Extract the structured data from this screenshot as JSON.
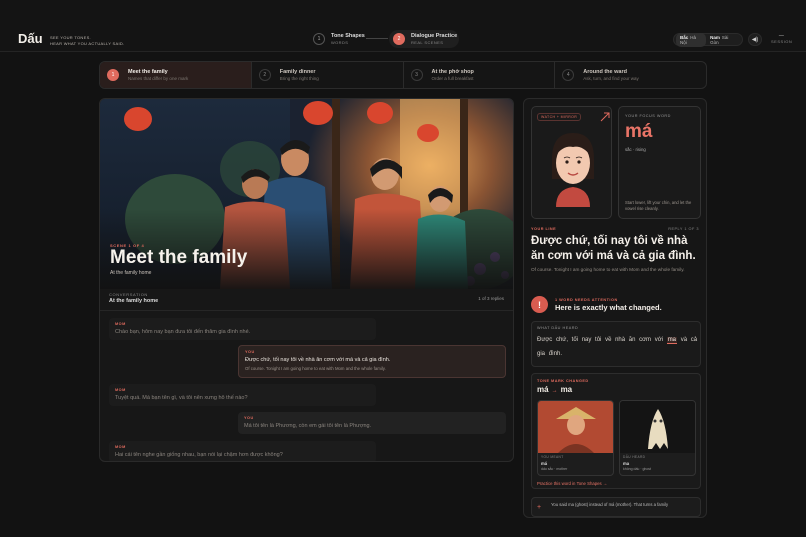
{
  "app": {
    "logo": "Dấu",
    "tagline_line1": "SEE YOUR TONES.",
    "tagline_line2": "HEAR WHAT YOU ACTUALLY SAID."
  },
  "steps": [
    {
      "num": "1",
      "title": "Tone Shapes",
      "subtitle": "WORDS"
    },
    {
      "num": "2",
      "title": "Dialogue Practice",
      "subtitle": "REAL SCENES"
    }
  ],
  "dialect": {
    "options": [
      {
        "name": "Bắc",
        "sub": "Hà Nội"
      },
      {
        "name": "Nam",
        "sub": "Sài Gòn"
      }
    ],
    "selected": "Bắc"
  },
  "session": {
    "value": "—",
    "label": "SESSION"
  },
  "scenes": [
    {
      "num": "1",
      "title": "Meet the family",
      "subtitle": "Names that differ by one mark"
    },
    {
      "num": "2",
      "title": "Family dinner",
      "subtitle": "Bring the right thing"
    },
    {
      "num": "3",
      "title": "At the phở shop",
      "subtitle": "Order a full breakfast"
    },
    {
      "num": "4",
      "title": "Around the ward",
      "subtitle": "Ask, turn, and find your way"
    }
  ],
  "scene": {
    "of_label": "SCENE 1 OF 4",
    "title": "Meet the family",
    "location": "At the family home"
  },
  "conversation": {
    "label": "CONVERSATION",
    "location": "At the family home",
    "count": "1 of 3 replies",
    "messages": [
      {
        "who": "MOM",
        "line": "Chào bạn, hôm nay bạn đưa tôi đến thăm gia đình nhé.",
        "tr": ""
      },
      {
        "who": "YOU",
        "line": "Được chứ, tối nay tôi về nhà ăn cơm với má và cả gia đình.",
        "tr": "Of course. Tonight I am going home to eat with Mom and the whole family."
      },
      {
        "who": "MOM",
        "line": "Tuyệt quá. Má bạn tên gì, và tôi nên xưng hô thế nào?",
        "tr": ""
      },
      {
        "who": "YOU",
        "line": "Má tôi tên là Phương, còn em gái tôi tên là Phượng.",
        "tr": ""
      },
      {
        "who": "MOM",
        "line": "Hai cái tên nghe gần giống nhau, bạn nói lại chậm hơn được không?",
        "tr": ""
      }
    ]
  },
  "mirror": {
    "tag": "WATCH + MIRROR"
  },
  "focus": {
    "label": "YOUR FOCUS WORD",
    "word": "má",
    "tone": "sắc · rising",
    "hint": "Start lower, lift your chin, and let the vowel rise cleanly."
  },
  "your_line": {
    "label": "YOUR LINE",
    "count": "REPLY 1 OF 3",
    "text": "Được chứ, tối nay tôi về nhà ăn cơm với má và cả gia đình.",
    "translation": "Of course. Tonight I am going home to eat with Mom and the whole family."
  },
  "attention": {
    "icon": "!",
    "kicker": "1 WORD NEEDS ATTENTION",
    "headline": "Here is exactly what changed."
  },
  "heard": {
    "label": "WHAT DẤU HEARD",
    "words": [
      "Được",
      "chứ,",
      "tối",
      "nay",
      "tôi",
      "về",
      "nhà",
      "ăn",
      "cơm",
      "với",
      "ma",
      "và",
      "cả",
      "gia",
      "đình."
    ],
    "flagged_index": 10
  },
  "tone_change": {
    "label": "TONE MARK CHANGED",
    "from": "má",
    "to": "ma",
    "arrow": "→",
    "cards": [
      {
        "kicker": "YOU MEANT",
        "word": "má",
        "meaning": "dấu sắc · mother"
      },
      {
        "kicker": "DẤU HEARD",
        "word": "ma",
        "meaning": "không dấu · ghost"
      }
    ],
    "practice_link": "Practice this word in Tone Shapes →"
  },
  "note": {
    "icon": "+",
    "text": "You said ma (ghost) instead of má (mother). That turns a family"
  },
  "colors": {
    "accent": "#e06b5e",
    "bg": "#121212"
  }
}
